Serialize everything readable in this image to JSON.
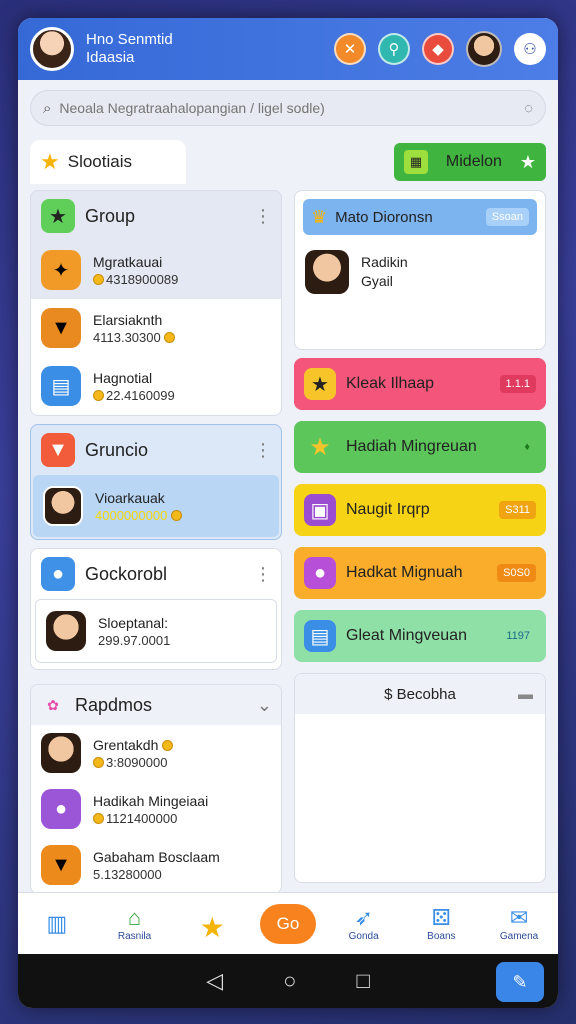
{
  "header": {
    "title_line1": "Hno Senmtid",
    "title_line2": "Idaasia"
  },
  "search": {
    "placeholder": "Neoala Negratraahalopangian / ligel sodle)"
  },
  "slots_tab": {
    "label": "Slootiais"
  },
  "mission_button": {
    "label": "Midelon"
  },
  "left": {
    "group": {
      "title": "Group",
      "items": [
        {
          "name": "Mgratkauai",
          "value": "4318900089"
        },
        {
          "name": "Elarsiaknth",
          "value": "4113.30300"
        },
        {
          "name": "Hagnotial",
          "value": "22.4160099"
        }
      ]
    },
    "grupo": {
      "title": "Gruncio",
      "items": [
        {
          "name": "Vioarkauak",
          "value": "4000000000"
        }
      ]
    },
    "geckorobl": {
      "title": "Gockorobl",
      "items": [
        {
          "name": "Sloeptanal:",
          "value": "299.97.0001"
        }
      ]
    },
    "rapidos": {
      "title": "Rapdmos",
      "items": [
        {
          "name": "Grentakdh",
          "value": "3:8090000"
        },
        {
          "name": "Hadikah Mingeiaai",
          "value": "1121400000"
        },
        {
          "name": "Gabaham Bosclaam",
          "value": "5.13280000"
        }
      ]
    }
  },
  "right": {
    "mato": {
      "title": "Mato Dioronsn",
      "badge": "Ssoan",
      "user_name": "Radikin",
      "user_sub": "Gyail"
    },
    "rows": [
      {
        "label": "Kleak Ilhaap",
        "badge": "1.1.1",
        "color": "#f4557a",
        "badge_color": "#e03a5f"
      },
      {
        "label": "Hadiah Mingreuan",
        "badge": "♦",
        "color": "#5cc65a",
        "badge_color": "#47a745"
      },
      {
        "label": "Naugit Irqrp",
        "badge": "S311",
        "color": "#f7d315",
        "badge_color": "#f0a412"
      },
      {
        "label": "Hadkat Mignuah",
        "badge": "S0S0",
        "color": "#f9ad2a",
        "badge_color": "#ef8b14"
      },
      {
        "label": "Gleat Mingveuan",
        "badge": "1197",
        "color": "#8fe0a6",
        "badge_color": "#52c07b"
      }
    ],
    "bottom_card": {
      "title": "$ Becobha"
    }
  },
  "bottom_nav": {
    "items": [
      {
        "label": "",
        "icon": "stats-icon"
      },
      {
        "label": "Rasnila",
        "icon": "home-icon"
      },
      {
        "label": "",
        "icon": "star-icon"
      },
      {
        "label": "Go",
        "icon": "go-button"
      },
      {
        "label": "Gonda",
        "icon": "rocket-icon"
      },
      {
        "label": "Boans",
        "icon": "game-icon"
      },
      {
        "label": "Gamena",
        "icon": "mail-icon"
      }
    ]
  }
}
